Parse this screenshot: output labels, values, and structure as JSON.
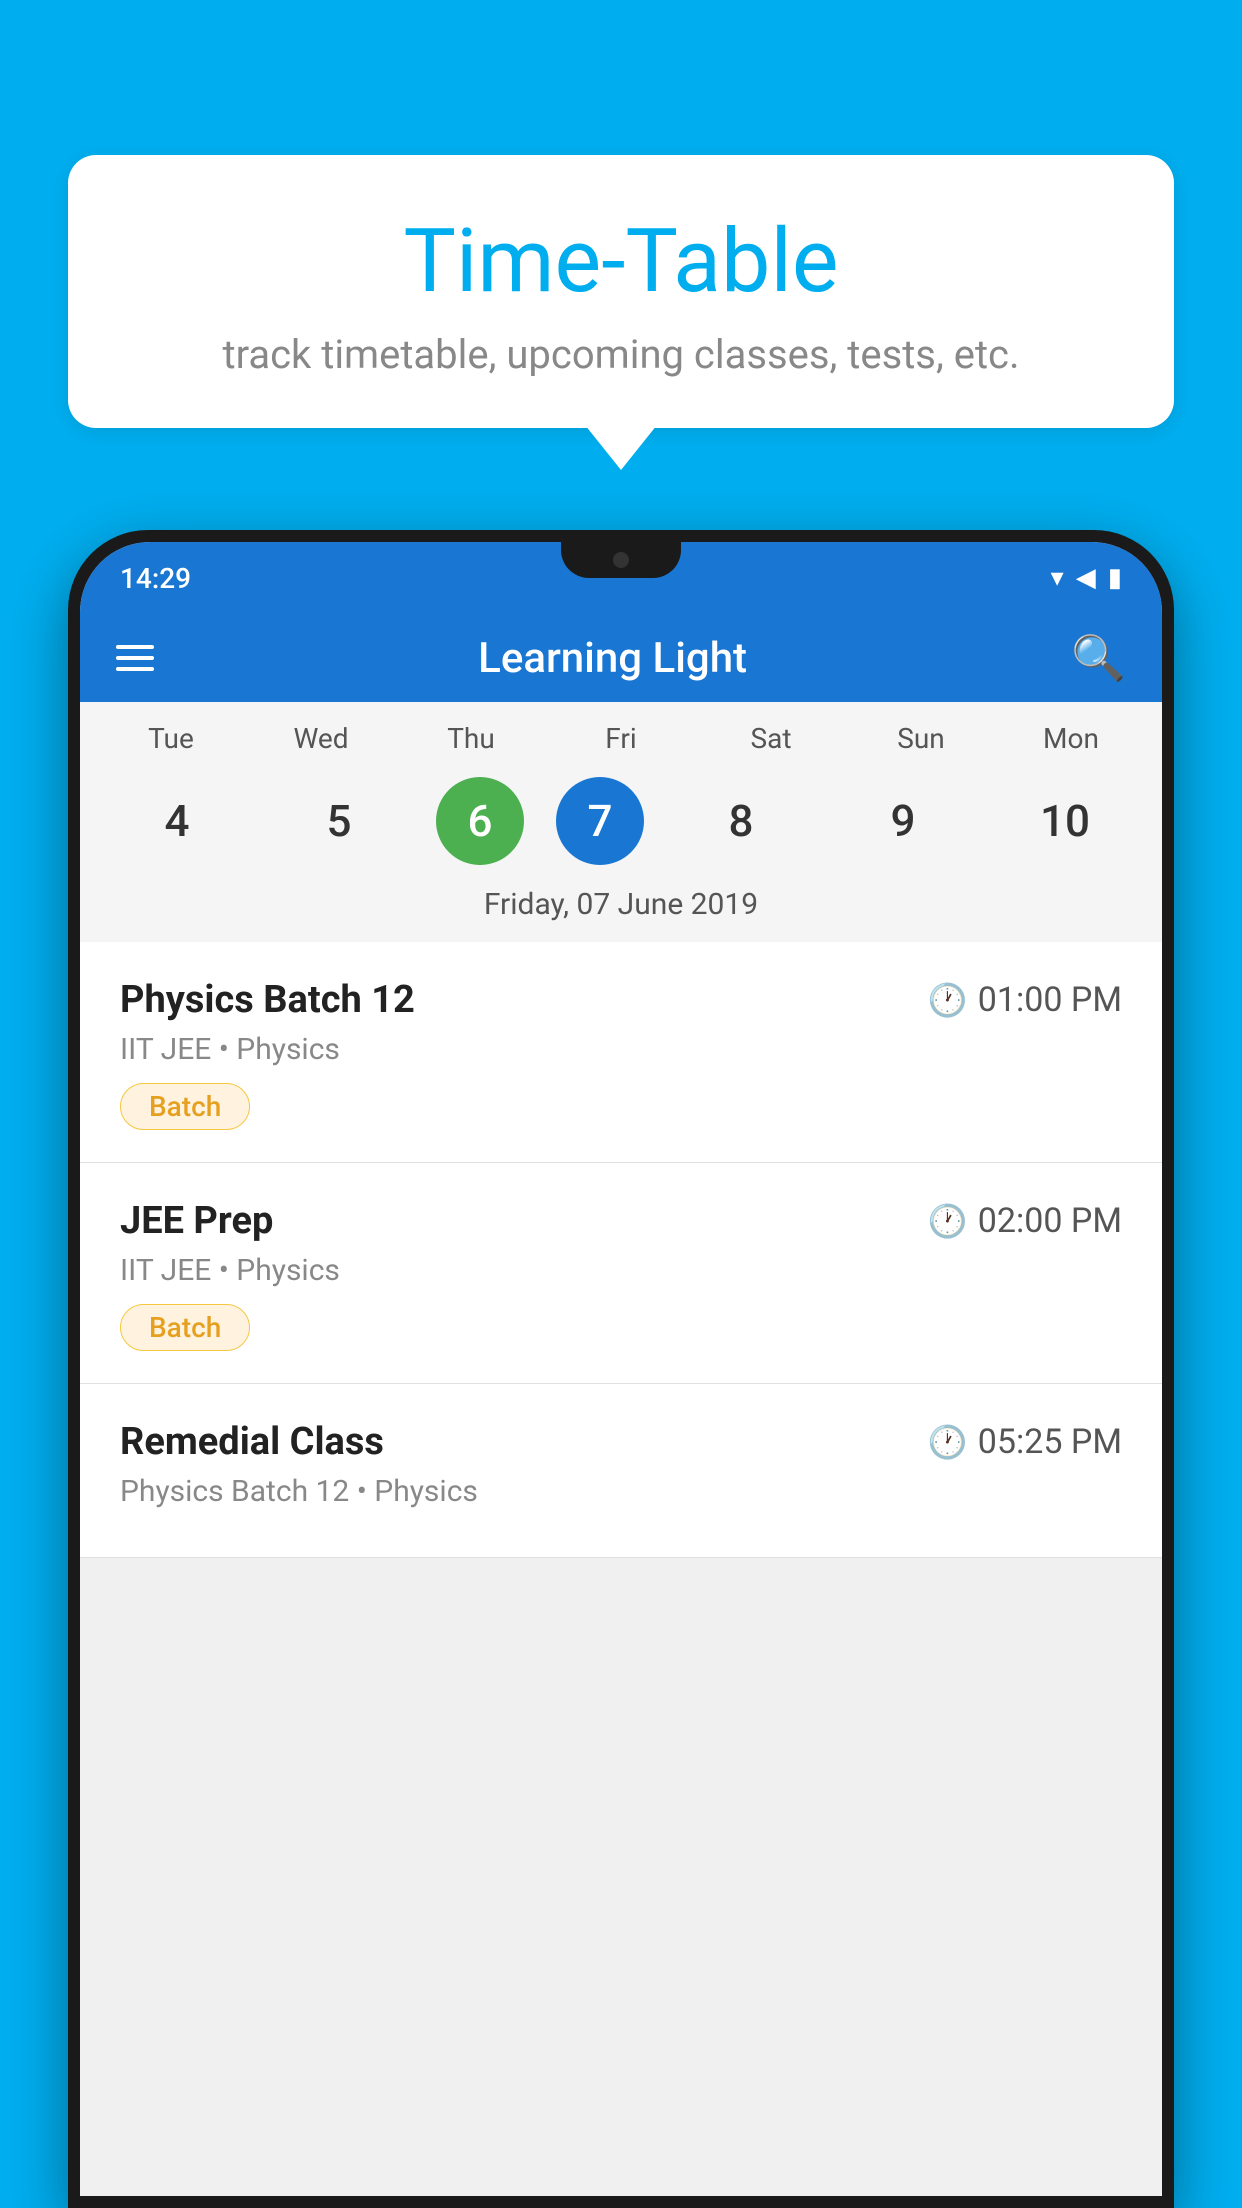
{
  "background": {
    "color": "#00AEEF"
  },
  "speech_bubble": {
    "title": "Time-Table",
    "subtitle": "track timetable, upcoming classes, tests, etc."
  },
  "phone": {
    "status_bar": {
      "time": "14:29"
    },
    "app_bar": {
      "title": "Learning Light",
      "hamburger_label": "menu",
      "search_label": "search"
    },
    "calendar": {
      "days": [
        {
          "label": "Tue",
          "number": "4"
        },
        {
          "label": "Wed",
          "number": "5"
        },
        {
          "label": "Thu",
          "number": "6",
          "state": "today"
        },
        {
          "label": "Fri",
          "number": "7",
          "state": "selected"
        },
        {
          "label": "Sat",
          "number": "8"
        },
        {
          "label": "Sun",
          "number": "9"
        },
        {
          "label": "Mon",
          "number": "10"
        }
      ],
      "selected_date": "Friday, 07 June 2019"
    },
    "classes": [
      {
        "name": "Physics Batch 12",
        "time": "01:00 PM",
        "subtitle": "IIT JEE • Physics",
        "tag": "Batch"
      },
      {
        "name": "JEE Prep",
        "time": "02:00 PM",
        "subtitle": "IIT JEE • Physics",
        "tag": "Batch"
      },
      {
        "name": "Remedial Class",
        "time": "05:25 PM",
        "subtitle": "Physics Batch 12 • Physics",
        "tag": ""
      }
    ]
  }
}
